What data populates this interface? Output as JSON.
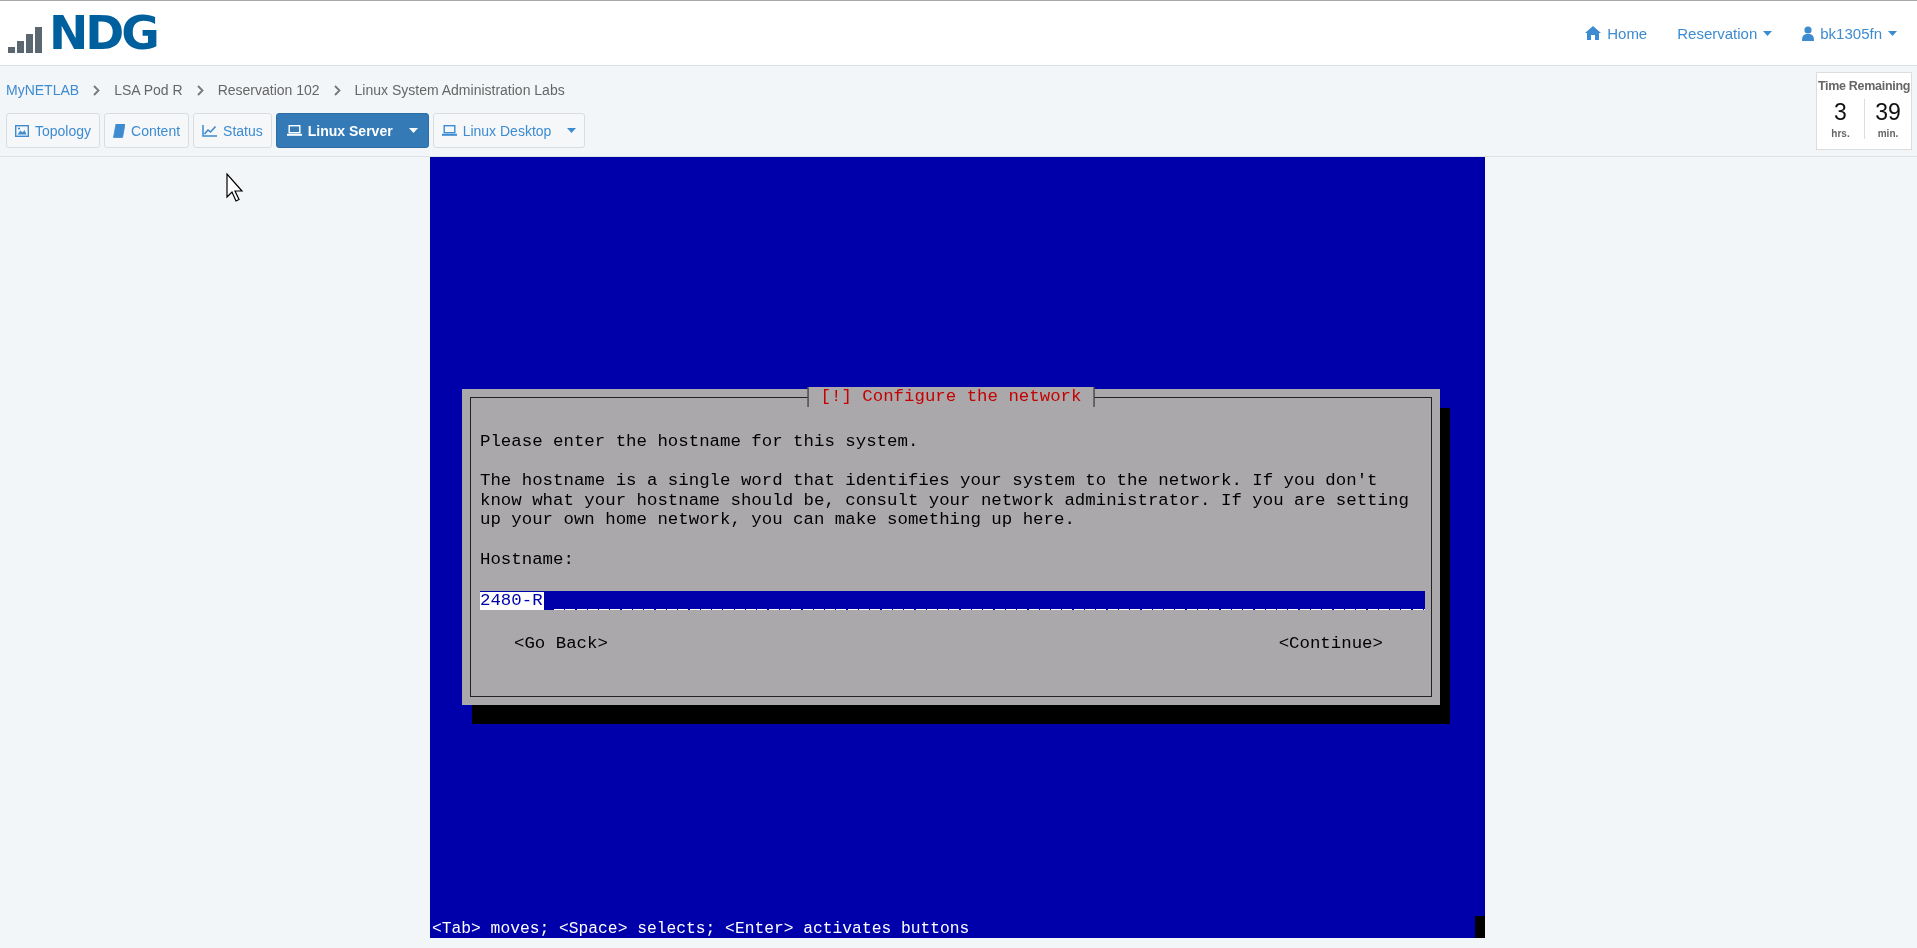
{
  "header": {
    "logo": "NDG",
    "nav": [
      {
        "label": "Home"
      },
      {
        "label": "Reservation"
      },
      {
        "label": "bk1305fn"
      }
    ]
  },
  "breadcrumbs": [
    "MyNETLAB",
    "LSA Pod R",
    "Reservation 102",
    "Linux System Administration Labs"
  ],
  "tabs": [
    {
      "label": "Topology",
      "selected": false
    },
    {
      "label": "Content",
      "selected": false
    },
    {
      "label": "Status",
      "selected": false
    },
    {
      "label": "Linux Server",
      "selected": true
    },
    {
      "label": "Linux Desktop",
      "selected": false
    }
  ],
  "time_remaining": {
    "title": "Time Remaining",
    "hours": "3",
    "hours_unit": "hrs.",
    "minutes": "39",
    "minutes_unit": "min."
  },
  "console": {
    "dialog": {
      "title": "[!] Configure the network",
      "prompt": "Please enter the hostname for this system.",
      "explanation": "The hostname is a single word that identifies your system to the network. If you don't\nknow what your hostname should be, consult your network administrator. If you are setting\nup your own home network, you can make something up here.",
      "field_label": "Hostname:",
      "field_value": "2480-R",
      "buttons": [
        "<Go Back>",
        "<Continue>"
      ]
    },
    "status_line": "<Tab> moves; <Space> selects; <Enter> activates buttons"
  }
}
